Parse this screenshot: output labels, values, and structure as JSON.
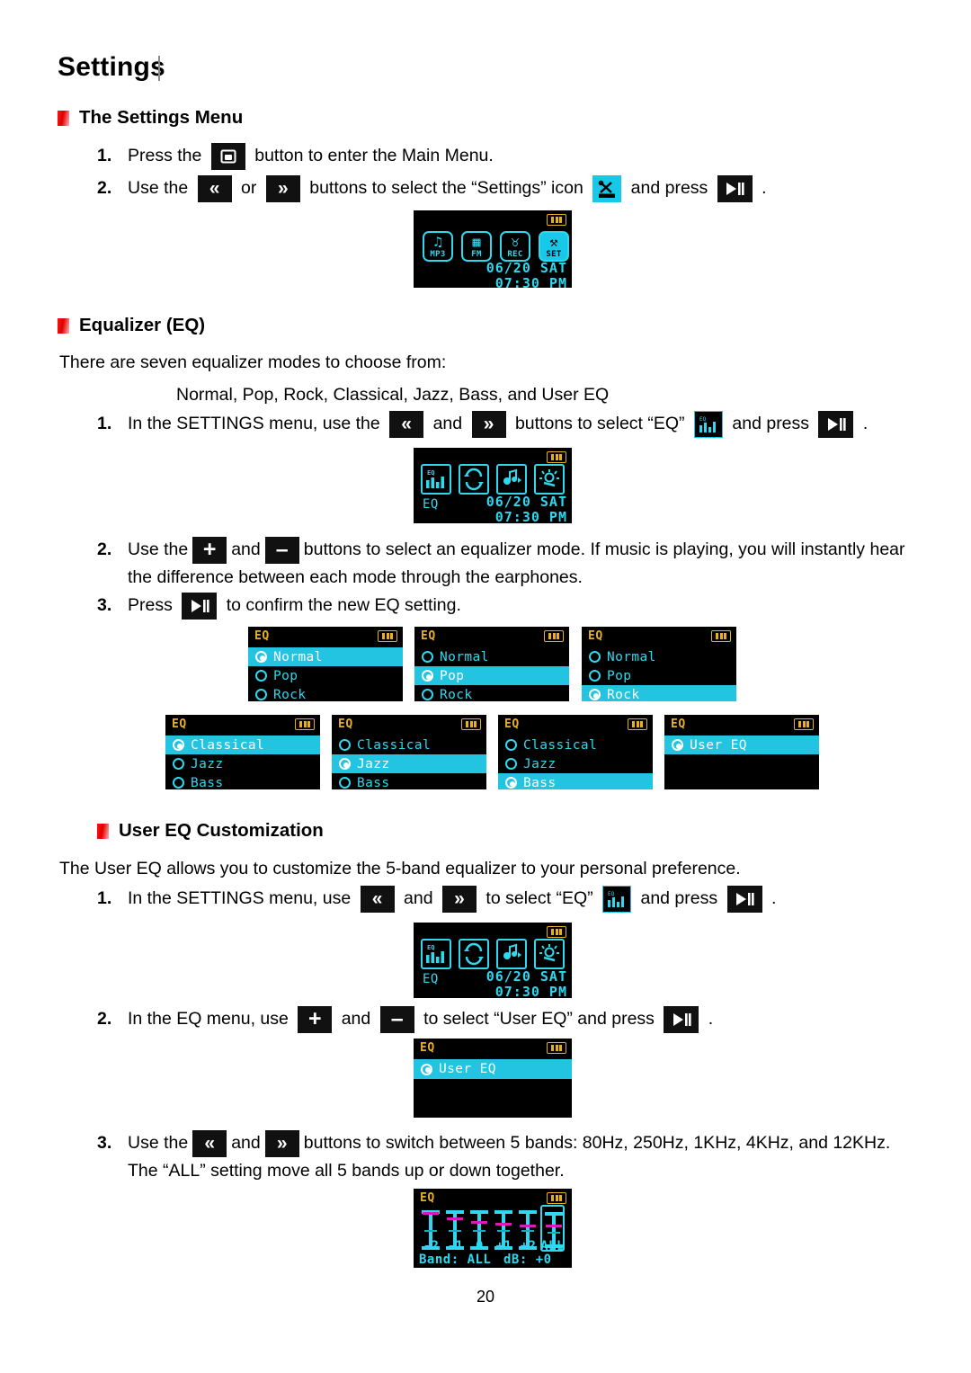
{
  "page": {
    "title": "Settings",
    "number": "20"
  },
  "sections": {
    "settings_menu": {
      "heading": "The Settings Menu",
      "steps": [
        {
          "num": "1.",
          "a": "Press the",
          "b": "button to enter the Main Menu."
        },
        {
          "num": "2.",
          "a": "Use the",
          "b": "or",
          "c": "buttons to select the “Settings” icon",
          "d": "and press",
          "e": "."
        }
      ]
    },
    "equalizer": {
      "heading": "Equalizer (EQ)",
      "intro": "There are seven equalizer modes to choose from:",
      "modes_line": "Normal, Pop, Rock, Classical, Jazz, Bass, and User EQ",
      "steps": [
        {
          "num": "1.",
          "a": "In the SETTINGS menu, use the",
          "b": "and",
          "c": "buttons to select “EQ”",
          "d": "and press",
          "e": "."
        },
        {
          "num": "2.",
          "a": "Use the",
          "b": "and",
          "c": "buttons to select an equalizer mode. If music is playing, you will instantly hear",
          "line2": "the difference between each mode through the earphones."
        },
        {
          "num": "3.",
          "a": "Press",
          "b": "to confirm the new EQ setting."
        }
      ]
    },
    "user_eq": {
      "heading": "User EQ Customization",
      "intro": "The User EQ allows you to customize the 5-band equalizer to your personal preference.",
      "steps": [
        {
          "num": "1.",
          "a": "In the SETTINGS menu, use",
          "b": "and",
          "c": "to select “EQ”",
          "d": "and press",
          "e": "."
        },
        {
          "num": "2.",
          "a": "In the EQ menu, use",
          "b": "and",
          "c": "to select “User EQ” and press",
          "d": "."
        },
        {
          "num": "3.",
          "a": "Use the",
          "b": "and",
          "c": "buttons to switch between 5 bands: 80Hz, 250Hz, 1KHz, 4KHz, and 12KHz.",
          "line2": "The “ALL” setting move all 5 bands up or down together."
        }
      ]
    }
  },
  "keys": {
    "menu": "menu-button-icon",
    "prev": "«",
    "next": "»",
    "play_pause": "play-pause-icon",
    "plus": "+",
    "minus": "–",
    "settings_icon": "settings-tools-icon",
    "eq_icon": "eq-bars-icon"
  },
  "screens": {
    "main_menu": {
      "items": [
        {
          "cap": "MP3",
          "glyph": "♫"
        },
        {
          "cap": "FM",
          "glyph": "▦"
        },
        {
          "cap": "REC",
          "glyph": "♉"
        },
        {
          "cap": "SET",
          "glyph": "⚒"
        }
      ],
      "selected": "SET",
      "date": "06/20 SAT",
      "time": "07:30 PM"
    },
    "settings_eq": {
      "title_small": "EQ",
      "label": "EQ",
      "icons": [
        "eq-bars-icon",
        "repeat-icon",
        "sound-effect-icon",
        "brightness-icon",
        "contrast-icon"
      ],
      "selected_index": 0,
      "date": "06/20 SAT",
      "time": "07:30 PM"
    },
    "eq_modes": [
      {
        "title": "EQ",
        "rows": [
          {
            "label": "Normal",
            "checked": true,
            "selected": true
          },
          {
            "label": "Pop",
            "checked": false,
            "selected": false
          },
          {
            "label": "Rock",
            "checked": false,
            "selected": false
          }
        ]
      },
      {
        "title": "EQ",
        "rows": [
          {
            "label": "Normal",
            "checked": false,
            "selected": false
          },
          {
            "label": "Pop",
            "checked": true,
            "selected": true
          },
          {
            "label": "Rock",
            "checked": false,
            "selected": false
          }
        ]
      },
      {
        "title": "EQ",
        "rows": [
          {
            "label": "Normal",
            "checked": false,
            "selected": false
          },
          {
            "label": "Pop",
            "checked": false,
            "selected": false
          },
          {
            "label": "Rock",
            "checked": true,
            "selected": true
          }
        ]
      },
      {
        "title": "EQ",
        "rows": [
          {
            "label": "Classical",
            "checked": true,
            "selected": true
          },
          {
            "label": "Jazz",
            "checked": false,
            "selected": false
          },
          {
            "label": "Bass",
            "checked": false,
            "selected": false
          }
        ]
      },
      {
        "title": "EQ",
        "rows": [
          {
            "label": "Classical",
            "checked": false,
            "selected": false
          },
          {
            "label": "Jazz",
            "checked": true,
            "selected": true
          },
          {
            "label": "Bass",
            "checked": false,
            "selected": false
          }
        ]
      },
      {
        "title": "EQ",
        "rows": [
          {
            "label": "Classical",
            "checked": false,
            "selected": false
          },
          {
            "label": "Jazz",
            "checked": false,
            "selected": false
          },
          {
            "label": "Bass",
            "checked": true,
            "selected": true
          }
        ]
      },
      {
        "title": "EQ",
        "rows": [
          {
            "label": "User EQ",
            "checked": true,
            "selected": true
          }
        ]
      }
    ],
    "user_eq_select": {
      "title": "EQ",
      "rows": [
        {
          "label": "User EQ",
          "checked": true,
          "selected": true
        }
      ]
    },
    "bands": {
      "title": "EQ",
      "labels": [
        "-2",
        "-1",
        "0",
        "+1",
        "+2",
        "ALL"
      ],
      "knob_pct": [
        8,
        14,
        18,
        20,
        22,
        20
      ],
      "boxed_index": 5,
      "band_text": "Band: ALL",
      "db_text": "dB: +0"
    }
  },
  "colors": {
    "accent_red": "#e81010",
    "screen_cyan": "#2fd8ef",
    "screen_highlight": "#22c4e2",
    "screen_amber": "#e8b020",
    "screen_bg": "#000000"
  }
}
